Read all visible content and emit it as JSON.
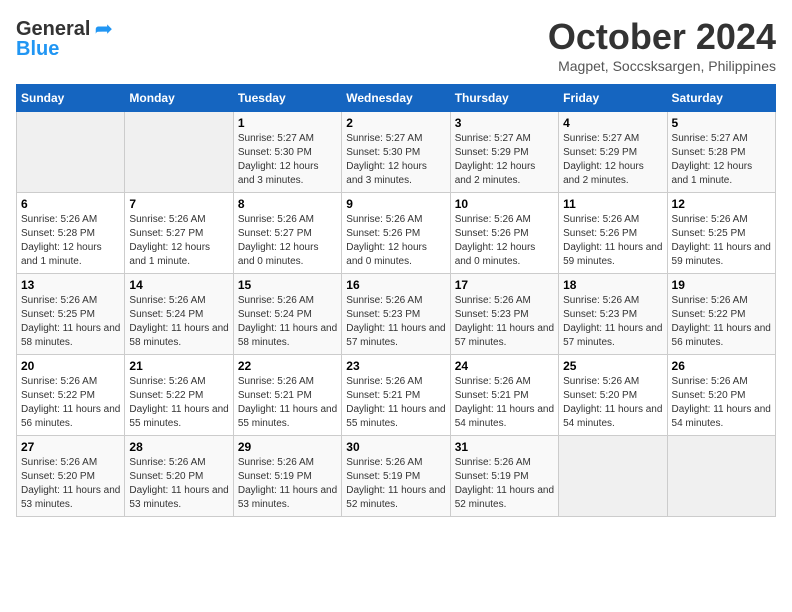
{
  "header": {
    "logo_line1": "General",
    "logo_line2": "Blue",
    "month_title": "October 2024",
    "location": "Magpet, Soccsksargen, Philippines"
  },
  "days_of_week": [
    "Sunday",
    "Monday",
    "Tuesday",
    "Wednesday",
    "Thursday",
    "Friday",
    "Saturday"
  ],
  "weeks": [
    [
      {
        "day": "",
        "info": ""
      },
      {
        "day": "",
        "info": ""
      },
      {
        "day": "1",
        "info": "Sunrise: 5:27 AM\nSunset: 5:30 PM\nDaylight: 12 hours and 3 minutes."
      },
      {
        "day": "2",
        "info": "Sunrise: 5:27 AM\nSunset: 5:30 PM\nDaylight: 12 hours and 3 minutes."
      },
      {
        "day": "3",
        "info": "Sunrise: 5:27 AM\nSunset: 5:29 PM\nDaylight: 12 hours and 2 minutes."
      },
      {
        "day": "4",
        "info": "Sunrise: 5:27 AM\nSunset: 5:29 PM\nDaylight: 12 hours and 2 minutes."
      },
      {
        "day": "5",
        "info": "Sunrise: 5:27 AM\nSunset: 5:28 PM\nDaylight: 12 hours and 1 minute."
      }
    ],
    [
      {
        "day": "6",
        "info": "Sunrise: 5:26 AM\nSunset: 5:28 PM\nDaylight: 12 hours and 1 minute."
      },
      {
        "day": "7",
        "info": "Sunrise: 5:26 AM\nSunset: 5:27 PM\nDaylight: 12 hours and 1 minute."
      },
      {
        "day": "8",
        "info": "Sunrise: 5:26 AM\nSunset: 5:27 PM\nDaylight: 12 hours and 0 minutes."
      },
      {
        "day": "9",
        "info": "Sunrise: 5:26 AM\nSunset: 5:26 PM\nDaylight: 12 hours and 0 minutes."
      },
      {
        "day": "10",
        "info": "Sunrise: 5:26 AM\nSunset: 5:26 PM\nDaylight: 12 hours and 0 minutes."
      },
      {
        "day": "11",
        "info": "Sunrise: 5:26 AM\nSunset: 5:26 PM\nDaylight: 11 hours and 59 minutes."
      },
      {
        "day": "12",
        "info": "Sunrise: 5:26 AM\nSunset: 5:25 PM\nDaylight: 11 hours and 59 minutes."
      }
    ],
    [
      {
        "day": "13",
        "info": "Sunrise: 5:26 AM\nSunset: 5:25 PM\nDaylight: 11 hours and 58 minutes."
      },
      {
        "day": "14",
        "info": "Sunrise: 5:26 AM\nSunset: 5:24 PM\nDaylight: 11 hours and 58 minutes."
      },
      {
        "day": "15",
        "info": "Sunrise: 5:26 AM\nSunset: 5:24 PM\nDaylight: 11 hours and 58 minutes."
      },
      {
        "day": "16",
        "info": "Sunrise: 5:26 AM\nSunset: 5:23 PM\nDaylight: 11 hours and 57 minutes."
      },
      {
        "day": "17",
        "info": "Sunrise: 5:26 AM\nSunset: 5:23 PM\nDaylight: 11 hours and 57 minutes."
      },
      {
        "day": "18",
        "info": "Sunrise: 5:26 AM\nSunset: 5:23 PM\nDaylight: 11 hours and 57 minutes."
      },
      {
        "day": "19",
        "info": "Sunrise: 5:26 AM\nSunset: 5:22 PM\nDaylight: 11 hours and 56 minutes."
      }
    ],
    [
      {
        "day": "20",
        "info": "Sunrise: 5:26 AM\nSunset: 5:22 PM\nDaylight: 11 hours and 56 minutes."
      },
      {
        "day": "21",
        "info": "Sunrise: 5:26 AM\nSunset: 5:22 PM\nDaylight: 11 hours and 55 minutes."
      },
      {
        "day": "22",
        "info": "Sunrise: 5:26 AM\nSunset: 5:21 PM\nDaylight: 11 hours and 55 minutes."
      },
      {
        "day": "23",
        "info": "Sunrise: 5:26 AM\nSunset: 5:21 PM\nDaylight: 11 hours and 55 minutes."
      },
      {
        "day": "24",
        "info": "Sunrise: 5:26 AM\nSunset: 5:21 PM\nDaylight: 11 hours and 54 minutes."
      },
      {
        "day": "25",
        "info": "Sunrise: 5:26 AM\nSunset: 5:20 PM\nDaylight: 11 hours and 54 minutes."
      },
      {
        "day": "26",
        "info": "Sunrise: 5:26 AM\nSunset: 5:20 PM\nDaylight: 11 hours and 54 minutes."
      }
    ],
    [
      {
        "day": "27",
        "info": "Sunrise: 5:26 AM\nSunset: 5:20 PM\nDaylight: 11 hours and 53 minutes."
      },
      {
        "day": "28",
        "info": "Sunrise: 5:26 AM\nSunset: 5:20 PM\nDaylight: 11 hours and 53 minutes."
      },
      {
        "day": "29",
        "info": "Sunrise: 5:26 AM\nSunset: 5:19 PM\nDaylight: 11 hours and 53 minutes."
      },
      {
        "day": "30",
        "info": "Sunrise: 5:26 AM\nSunset: 5:19 PM\nDaylight: 11 hours and 52 minutes."
      },
      {
        "day": "31",
        "info": "Sunrise: 5:26 AM\nSunset: 5:19 PM\nDaylight: 11 hours and 52 minutes."
      },
      {
        "day": "",
        "info": ""
      },
      {
        "day": "",
        "info": ""
      }
    ]
  ]
}
